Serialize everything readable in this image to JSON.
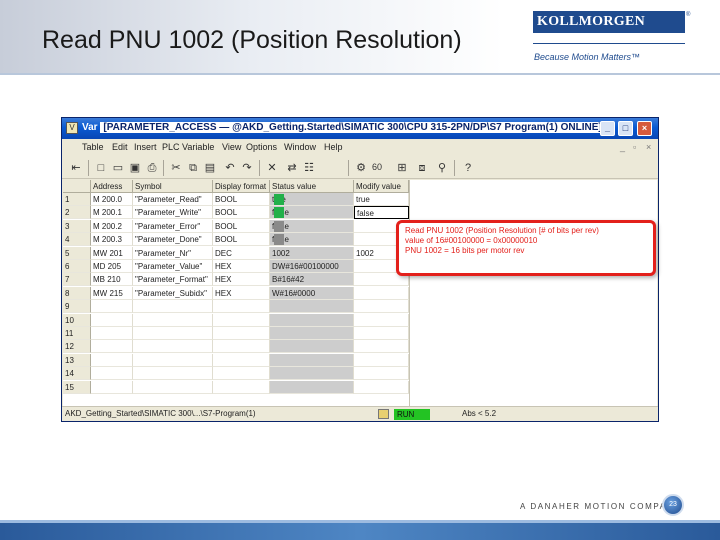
{
  "slide": {
    "title": "Read PNU 1002 (Position Resolution)",
    "logo": "KOLLMORGEN",
    "logo_mark": "®",
    "tagline": "Because Motion Matters™",
    "footer_brand": "A DANAHER MOTION COMPANY",
    "page_number": "23"
  },
  "window": {
    "app_icon": "V",
    "title_prefix": "Var",
    "title": "[PARAMETER_ACCESS — @AKD_Getting.Started\\SIMATIC 300\\CPU 315-2PN/DP\\S7 Program(1) ONLINE]",
    "buttons": {
      "minimize": "_",
      "maximize": "□",
      "close": "×"
    }
  },
  "menu": [
    "Table",
    "Edit",
    "Insert",
    "PLC",
    "Variable",
    "View",
    "Options",
    "Window",
    "Help"
  ],
  "mdi_controls": [
    "_",
    "▫",
    "×"
  ],
  "toolbar": {
    "icons": [
      "exit-icon",
      "new-icon",
      "open-icon",
      "save-icon",
      "print-icon",
      "cut-icon",
      "copy-icon",
      "paste-icon",
      "undo-icon",
      "redo-icon",
      "delete-icon",
      "online-icon",
      "monitor-icon",
      "modify-icon",
      "trigger-icon",
      "help-icon"
    ],
    "zoom_label": "60"
  },
  "table": {
    "headers": [
      "",
      "Address",
      "Symbol",
      "Display format",
      "Status value",
      "Modify value"
    ],
    "rows": [
      {
        "num": "1",
        "address": "M 200.0",
        "symbol": "\"Parameter_Read\"",
        "format": "BOOL",
        "status": "true",
        "modify": "true",
        "flag": "green"
      },
      {
        "num": "2",
        "address": "M 200.1",
        "symbol": "\"Parameter_Write\"",
        "format": "BOOL",
        "status": "false",
        "modify": "false",
        "flag": "green"
      },
      {
        "num": "3",
        "address": "M 200.2",
        "symbol": "\"Parameter_Error\"",
        "format": "BOOL",
        "status": "false",
        "modify": "",
        "flag": "gray"
      },
      {
        "num": "4",
        "address": "M 200.3",
        "symbol": "\"Parameter_Done\"",
        "format": "BOOL",
        "status": "false",
        "modify": "",
        "flag": "gray"
      },
      {
        "num": "5",
        "address": "MW 201",
        "symbol": "\"Parameter_Nr\"",
        "format": "DEC",
        "status": "1002",
        "modify": "1002",
        "flag": ""
      },
      {
        "num": "6",
        "address": "MD 205",
        "symbol": "\"Parameter_Value\"",
        "format": "HEX",
        "status": "DW#16#00100000",
        "modify": "",
        "flag": ""
      },
      {
        "num": "7",
        "address": "MB 210",
        "symbol": "\"Parameter_Format\"",
        "format": "HEX",
        "status": "B#16#42",
        "modify": "",
        "flag": ""
      },
      {
        "num": "8",
        "address": "MW 215",
        "symbol": "\"Parameter_Subidx\"",
        "format": "HEX",
        "status": "W#16#0000",
        "modify": "",
        "flag": ""
      },
      {
        "num": "9",
        "address": "",
        "symbol": "",
        "format": "",
        "status": "",
        "modify": "",
        "flag": ""
      },
      {
        "num": "10",
        "address": "",
        "symbol": "",
        "format": "",
        "status": "",
        "modify": "",
        "flag": ""
      },
      {
        "num": "11",
        "address": "",
        "symbol": "",
        "format": "",
        "status": "",
        "modify": "",
        "flag": ""
      },
      {
        "num": "12",
        "address": "",
        "symbol": "",
        "format": "",
        "status": "",
        "modify": "",
        "flag": ""
      },
      {
        "num": "13",
        "address": "",
        "symbol": "",
        "format": "",
        "status": "",
        "modify": "",
        "flag": ""
      },
      {
        "num": "14",
        "address": "",
        "symbol": "",
        "format": "",
        "status": "",
        "modify": "",
        "flag": ""
      },
      {
        "num": "15",
        "address": "",
        "symbol": "",
        "format": "",
        "status": "",
        "modify": "",
        "flag": ""
      }
    ]
  },
  "statusbar": {
    "path": "AKD_Getting_Started\\SIMATIC 300\\...\\S7-Program(1)",
    "run": "RUN",
    "abs": "Abs < 5.2"
  },
  "callout": {
    "lines": [
      "Read PNU 1002 (Position Resolution [# of bits per rev)",
      "value of 16#00100000 = 0x00000010",
      "PNU 1002 = 16 bits per motor rev"
    ]
  },
  "colors": {
    "accent": "#1f4b8e",
    "callout_red": "#e3201b",
    "run_green": "#23c323",
    "flag_green": "#22b04a",
    "flag_gray": "#8a8a8a"
  }
}
